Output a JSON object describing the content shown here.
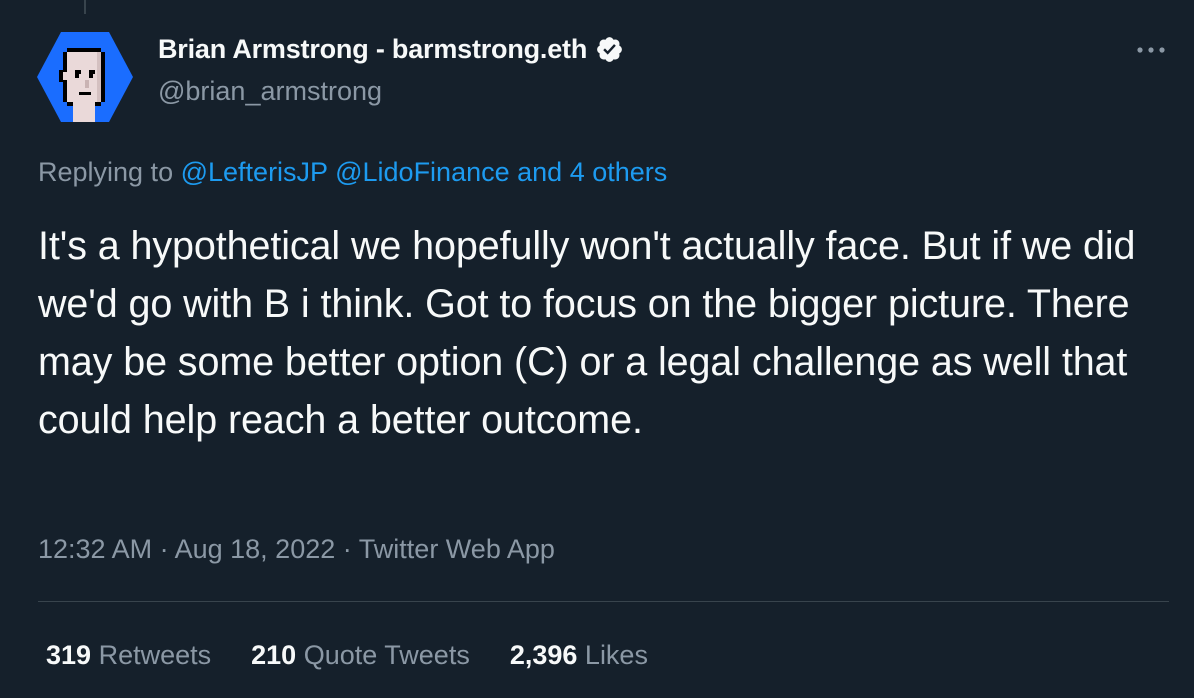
{
  "colors": {
    "background": "#15202b",
    "text": "#f7f9f9",
    "secondary_text": "#8b98a5",
    "link": "#1d9bf0",
    "divider": "#38444d",
    "avatar_bg": "#1a6dff"
  },
  "author": {
    "name": "Brian Armstrong - barmstrong.eth",
    "handle": "@brian_armstrong",
    "verified_icon": "verified-badge-icon",
    "avatar_icon": "pixel-punk-avatar"
  },
  "more_icon": "ellipsis-icon",
  "reply": {
    "prefix": "Replying to",
    "mention_1": "@LefterisJP",
    "mention_2": "@LidoFinance",
    "others": "and 4 others"
  },
  "tweet": {
    "text": "It's a hypothetical we hopefully won't actually face. But if we did we'd go with B i think. Got to focus on the bigger picture. There may be some better option (C) or a legal challenge as well that could help reach a better outcome."
  },
  "meta": {
    "time": "12:32 AM",
    "separator": "·",
    "date": "Aug 18, 2022",
    "source": "Twitter Web App"
  },
  "stats": {
    "retweets_count": "319",
    "retweets_label": "Retweets",
    "quotes_count": "210",
    "quotes_label": "Quote Tweets",
    "likes_count": "2,396",
    "likes_label": "Likes"
  }
}
